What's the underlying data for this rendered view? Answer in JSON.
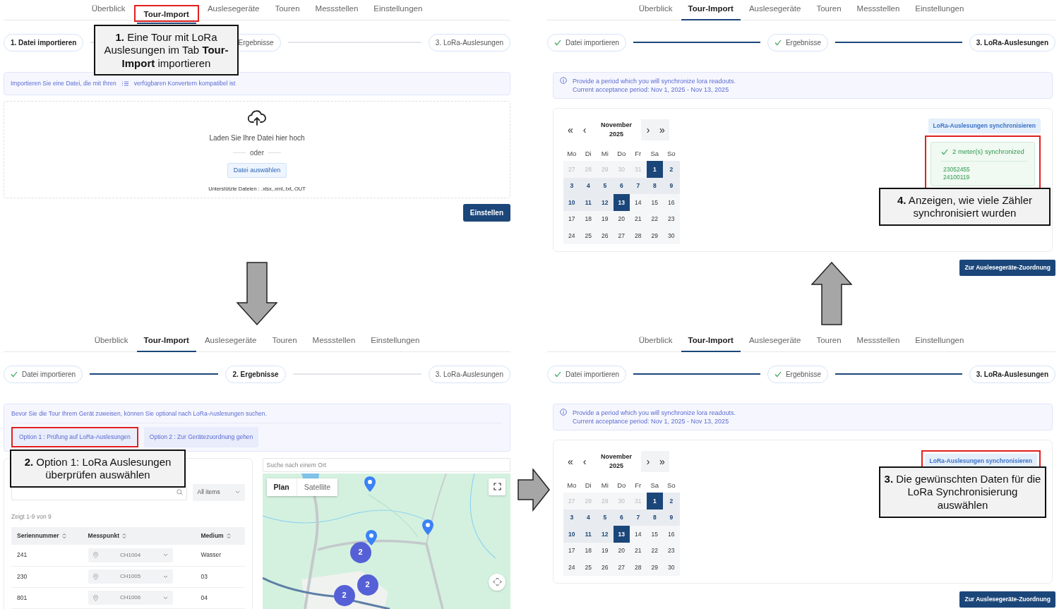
{
  "panels": [
    {
      "kind": "import",
      "tabs": [
        {
          "label": "Überblick",
          "selected": false,
          "highlighted": false
        },
        {
          "label": "Tour-Import",
          "selected": true,
          "highlighted": true
        },
        {
          "label": "Auslesegeräte",
          "selected": false,
          "highlighted": false
        },
        {
          "label": "Touren",
          "selected": false,
          "highlighted": false
        },
        {
          "label": "Messstellen",
          "selected": false,
          "highlighted": false
        },
        {
          "label": "Einstellungen",
          "selected": false,
          "highlighted": false
        }
      ],
      "steps": [
        {
          "number": "1.",
          "label": "Datei importieren",
          "done": false,
          "current": true
        },
        {
          "label": "Ergebnisse",
          "done": false,
          "current": false
        },
        {
          "number": "3.",
          "label": "LoRa-Auslesungen",
          "done": false,
          "current": false
        }
      ],
      "alert": {
        "text_before": "Importieren Sie eine Datei, die mit Ihren",
        "text_after": "verfügbaren Konvertern kompatibel ist"
      },
      "upload": {
        "prompt": "Laden Sie Ihre Datei hier hoch",
        "separator": "oder",
        "button": "Datei auswählen",
        "formats": "Unterstützte Dateien : .xlsx,.xml,.txt,.OUT"
      },
      "submit_button": "Einstellen"
    },
    {
      "kind": "lora",
      "tabs": [
        {
          "label": "Überblick",
          "selected": false
        },
        {
          "label": "Tour-Import",
          "selected": true
        },
        {
          "label": "Auslesegeräte",
          "selected": false
        },
        {
          "label": "Touren",
          "selected": false
        },
        {
          "label": "Messstellen",
          "selected": false
        },
        {
          "label": "Einstellungen",
          "selected": false
        }
      ],
      "steps": [
        {
          "label": "Datei importieren",
          "done": true,
          "current": false
        },
        {
          "label": "Ergebnisse",
          "done": true,
          "current": false
        },
        {
          "number": "3.",
          "label": "LoRa-Auslesungen",
          "done": false,
          "current": true
        }
      ],
      "alert_lines": [
        "Provide a period which you will synchronize lora readouts.",
        "Current acceptance period: Nov 1, 2025 - Nov 13, 2025"
      ],
      "calendar": {
        "nav": [
          "«",
          "‹",
          "›",
          "»"
        ],
        "month": "November",
        "year": "2025",
        "weekdays": [
          "Mo",
          "Di",
          "Mi",
          "Do",
          "Fr",
          "Sa",
          "So"
        ],
        "weeks": [
          [
            {
              "day": "27",
              "kind": "outside"
            },
            {
              "day": "28",
              "kind": "outside"
            },
            {
              "day": "29",
              "kind": "outside"
            },
            {
              "day": "30",
              "kind": "outside"
            },
            {
              "day": "31",
              "kind": "outside"
            },
            {
              "day": "1",
              "kind": "end"
            },
            {
              "day": "2",
              "kind": "range"
            }
          ],
          [
            {
              "day": "3",
              "kind": "range"
            },
            {
              "day": "4",
              "kind": "range"
            },
            {
              "day": "5",
              "kind": "range"
            },
            {
              "day": "6",
              "kind": "range"
            },
            {
              "day": "7",
              "kind": "range"
            },
            {
              "day": "8",
              "kind": "range"
            },
            {
              "day": "9",
              "kind": "range"
            }
          ],
          [
            {
              "day": "10",
              "kind": "range"
            },
            {
              "day": "11",
              "kind": "range"
            },
            {
              "day": "12",
              "kind": "range"
            },
            {
              "day": "13",
              "kind": "end"
            },
            {
              "day": "14",
              "kind": "normal"
            },
            {
              "day": "15",
              "kind": "normal"
            },
            {
              "day": "16",
              "kind": "normal"
            }
          ],
          [
            {
              "day": "17",
              "kind": "normal"
            },
            {
              "day": "18",
              "kind": "normal"
            },
            {
              "day": "19",
              "kind": "normal"
            },
            {
              "day": "20",
              "kind": "normal"
            },
            {
              "day": "21",
              "kind": "normal"
            },
            {
              "day": "22",
              "kind": "normal"
            },
            {
              "day": "23",
              "kind": "normal"
            }
          ],
          [
            {
              "day": "24",
              "kind": "normal"
            },
            {
              "day": "25",
              "kind": "normal"
            },
            {
              "day": "26",
              "kind": "normal"
            },
            {
              "day": "27",
              "kind": "normal"
            },
            {
              "day": "28",
              "kind": "normal"
            },
            {
              "day": "29",
              "kind": "normal"
            },
            {
              "day": "30",
              "kind": "normal"
            }
          ]
        ]
      },
      "sync_button": {
        "label": "LoRa-Auslesungen synchronisieren",
        "highlighted": false
      },
      "result": {
        "title": "2 meter(s) synchronized",
        "meters": [
          "23052455",
          "24100119"
        ],
        "highlighted": true
      },
      "next_button": "Zur Auslesegeräte-Zuordnung"
    },
    {
      "kind": "results",
      "tabs": [
        {
          "label": "Überblick",
          "selected": false
        },
        {
          "label": "Tour-Import",
          "selected": true
        },
        {
          "label": "Auslesegeräte",
          "selected": false
        },
        {
          "label": "Touren",
          "selected": false
        },
        {
          "label": "Messstellen",
          "selected": false
        },
        {
          "label": "Einstellungen",
          "selected": false
        }
      ],
      "steps": [
        {
          "label": "Datei importieren",
          "done": true,
          "current": false
        },
        {
          "number": "2.",
          "label": "Ergebnisse",
          "done": false,
          "current": true
        },
        {
          "number": "3.",
          "label": "LoRa-Auslesungen",
          "done": false,
          "current": false
        }
      ],
      "alert": "Bevor Sie die Tour Ihrem Gerät zuweisen, können Sie optional nach LoRa-Auslesungen suchen.",
      "options": [
        {
          "label": "Option 1 : Prüfung auf LoRa-Auslesungen",
          "highlighted": true
        },
        {
          "label": "Option 2 : Zur Gerätezuordnung gehen",
          "highlighted": false
        }
      ],
      "filter": "All items",
      "count": "Zeigt 1-9 von 9",
      "columns": [
        "Seriennummer",
        "Messpunkt",
        "Medium"
      ],
      "rows": [
        {
          "serial": "241",
          "point": "CH1004",
          "medium": "Wasser"
        },
        {
          "serial": "230",
          "point": "CH1005",
          "medium": "03"
        },
        {
          "serial": "801",
          "point": "CH1006",
          "medium": "04"
        }
      ],
      "map": {
        "search_placeholder": "Suche nach einem Ort",
        "types": [
          {
            "label": "Plan",
            "selected": true
          },
          {
            "label": "Satellite",
            "selected": false
          }
        ],
        "clusters": [
          "2",
          "2",
          "2"
        ]
      }
    },
    {
      "kind": "lora",
      "tabs": [
        {
          "label": "Überblick",
          "selected": false
        },
        {
          "label": "Tour-Import",
          "selected": true
        },
        {
          "label": "Auslesegeräte",
          "selected": false
        },
        {
          "label": "Touren",
          "selected": false
        },
        {
          "label": "Messstellen",
          "selected": false
        },
        {
          "label": "Einstellungen",
          "selected": false
        }
      ],
      "steps": [
        {
          "label": "Datei importieren",
          "done": true,
          "current": false
        },
        {
          "label": "Ergebnisse",
          "done": true,
          "current": false
        },
        {
          "number": "3.",
          "label": "LoRa-Auslesungen",
          "done": false,
          "current": true
        }
      ],
      "alert_lines": [
        "Provide a period which you will synchronize lora readouts.",
        "Current acceptance period: Nov 1, 2025 - Nov 13, 2025"
      ],
      "calendar": {
        "nav": [
          "«",
          "‹",
          "›",
          "»"
        ],
        "month": "November",
        "year": "2025",
        "weekdays": [
          "Mo",
          "Di",
          "Mi",
          "Do",
          "Fr",
          "Sa",
          "So"
        ],
        "weeks": [
          [
            {
              "day": "27",
              "kind": "outside"
            },
            {
              "day": "28",
              "kind": "outside"
            },
            {
              "day": "29",
              "kind": "outside"
            },
            {
              "day": "30",
              "kind": "outside"
            },
            {
              "day": "31",
              "kind": "outside"
            },
            {
              "day": "1",
              "kind": "end"
            },
            {
              "day": "2",
              "kind": "range"
            }
          ],
          [
            {
              "day": "3",
              "kind": "range"
            },
            {
              "day": "4",
              "kind": "range"
            },
            {
              "day": "5",
              "kind": "range"
            },
            {
              "day": "6",
              "kind": "range"
            },
            {
              "day": "7",
              "kind": "range"
            },
            {
              "day": "8",
              "kind": "range"
            },
            {
              "day": "9",
              "kind": "range"
            }
          ],
          [
            {
              "day": "10",
              "kind": "range"
            },
            {
              "day": "11",
              "kind": "range"
            },
            {
              "day": "12",
              "kind": "range"
            },
            {
              "day": "13",
              "kind": "end"
            },
            {
              "day": "14",
              "kind": "normal"
            },
            {
              "day": "15",
              "kind": "normal"
            },
            {
              "day": "16",
              "kind": "normal"
            }
          ],
          [
            {
              "day": "17",
              "kind": "normal"
            },
            {
              "day": "18",
              "kind": "normal"
            },
            {
              "day": "19",
              "kind": "normal"
            },
            {
              "day": "20",
              "kind": "normal"
            },
            {
              "day": "21",
              "kind": "normal"
            },
            {
              "day": "22",
              "kind": "normal"
            },
            {
              "day": "23",
              "kind": "normal"
            }
          ],
          [
            {
              "day": "24",
              "kind": "normal"
            },
            {
              "day": "25",
              "kind": "normal"
            },
            {
              "day": "26",
              "kind": "normal"
            },
            {
              "day": "27",
              "kind": "normal"
            },
            {
              "day": "28",
              "kind": "normal"
            },
            {
              "day": "29",
              "kind": "normal"
            },
            {
              "day": "30",
              "kind": "normal"
            }
          ]
        ]
      },
      "sync_button": {
        "label": "LoRa-Auslesungen synchronisieren",
        "highlighted": true
      },
      "next_button": "Zur Auslesegeräte-Zuordnung"
    }
  ],
  "annotations": [
    {
      "text": "**1.** Eine Tour mit LoRa Auslesungen im Tab **Tour-Import** importieren"
    },
    {
      "text": "**4.** Anzeigen, wie viele Zähler synchronisiert wurden"
    },
    {
      "text": "**2.** Option 1: LoRa Auslesungen überprüfen auswählen"
    },
    {
      "text": "**3.** Die gewünschten Daten für die LoRa Synchronisierung auswählen"
    }
  ]
}
